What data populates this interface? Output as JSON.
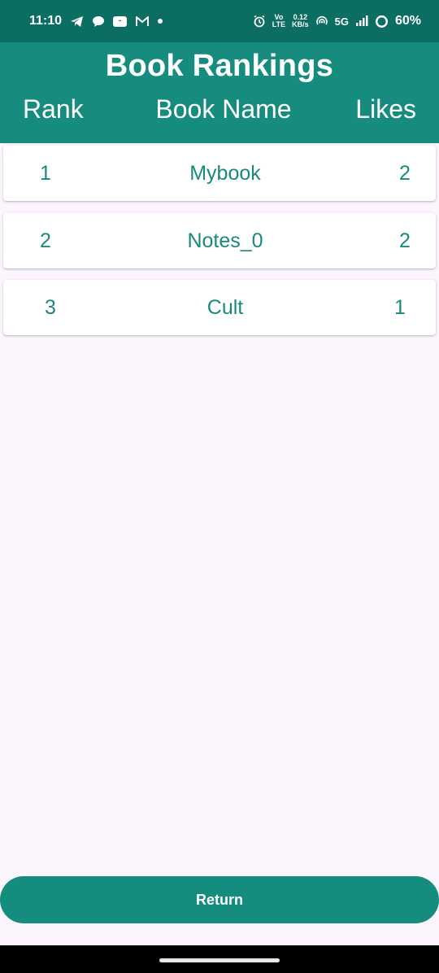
{
  "status_bar": {
    "time": "11:10",
    "volte_top": "Vo",
    "volte_bottom": "LTE",
    "speed_value": "0.12",
    "speed_unit": "KB/s",
    "network": "5G",
    "battery": "60%",
    "icons": [
      "telegram-icon",
      "chat-bubble-icon",
      "app-icon",
      "gmail-icon",
      "notification-dot-icon",
      "alarm-icon",
      "hotspot-icon",
      "signal-icon",
      "battery-icon"
    ]
  },
  "header": {
    "title": "Book Rankings",
    "columns": {
      "rank": "Rank",
      "name": "Book Name",
      "likes": "Likes"
    }
  },
  "rows": [
    {
      "rank": "1",
      "name": "Mybook",
      "likes": "2"
    },
    {
      "rank": "2",
      "name": "Notes_0",
      "likes": "2"
    },
    {
      "rank": "3",
      "name": "Cult",
      "likes": "1"
    }
  ],
  "return_button": {
    "label": "Return"
  },
  "colors": {
    "status_bar": "#0c6d62",
    "header": "#158c7e",
    "accent_text": "#188a7c",
    "background": "#fcf5fd",
    "button": "#148c7e"
  }
}
